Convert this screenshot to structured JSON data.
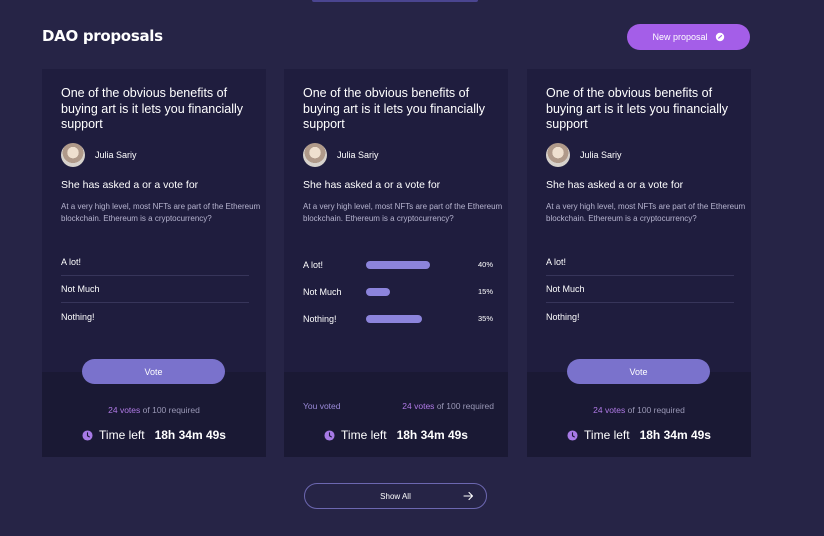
{
  "header": {
    "title": "DAO proposals",
    "new_proposal_label": "New proposal"
  },
  "cards": [
    {
      "title": "One of the obvious benefits of buying art is it lets you financially support",
      "author": "Julia Sariy",
      "question": "She has  asked a or a vote for",
      "description": "At a very high level, most NFTs are part of the Ethereum blockchain. Ethereum is a cryptocurrency?",
      "options": [
        "A lot!",
        "Not Much",
        "Nothing!"
      ],
      "vote_label": "Vote",
      "votes_count": "24 votes",
      "votes_suffix": "of 100 required",
      "time_label": "Time left",
      "time_value": "18h 34m 49s"
    },
    {
      "title": "One of the obvious benefits of buying art is it lets you financially support",
      "author": "Julia Sariy",
      "question": "She has  asked a or a vote for",
      "description": "At a very high level, most NFTs are part of the Ethereum blockchain. Ethereum is a cryptocurrency?",
      "results": [
        {
          "label": "A lot!",
          "percent": 40,
          "percent_text": "40%"
        },
        {
          "label": "Not Much",
          "percent": 15,
          "percent_text": "15%"
        },
        {
          "label": "Nothing!",
          "percent": 35,
          "percent_text": "35%"
        }
      ],
      "you_voted": "You voted",
      "votes_count": "24 votes",
      "votes_suffix": "of 100 required",
      "time_label": "Time left",
      "time_value": "18h 34m 49s"
    },
    {
      "title": "One of the obvious benefits of buying art is it lets you financially support",
      "author": "Julia Sariy",
      "question": "She has  asked a or a vote for",
      "description": "At a very high level, most NFTs are part of the Ethereum blockchain. Ethereum is a cryptocurrency?",
      "options": [
        "A lot!",
        "Not Much",
        "Nothing!"
      ],
      "vote_label": "Vote",
      "votes_count": "24 votes",
      "votes_suffix": "of 100 required",
      "time_label": "Time left",
      "time_value": "18h 34m 49s"
    }
  ],
  "footer": {
    "show_all_label": "Show All"
  },
  "icons": {
    "new_proposal": "chat-bubble-icon",
    "clock": "clock-icon",
    "show_all": "arrow-right-icon"
  },
  "colors": {
    "background": "#262446",
    "card": "#1f1d3e",
    "accent": "#a45ee8",
    "button": "#7a72cc",
    "bar": "#8c84dc"
  }
}
